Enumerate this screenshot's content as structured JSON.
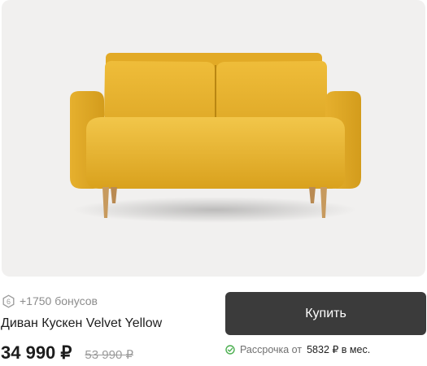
{
  "product": {
    "title": "Диван Кускен Velvet Yellow",
    "image_alt": "sofa-image",
    "color": "#e8b32c"
  },
  "bonus": {
    "icon": "bonus-coin-icon",
    "icon_digit": "6",
    "text": "+1750 бонусов"
  },
  "pricing": {
    "current": "34 990 ₽",
    "old": "53 990 ₽"
  },
  "buy_button": {
    "label": "Купить",
    "background": "#3b3b3b"
  },
  "installment": {
    "icon": "check-circle-icon",
    "prefix": "Рассрочка от",
    "amount": "5832 ₽ в мес."
  }
}
